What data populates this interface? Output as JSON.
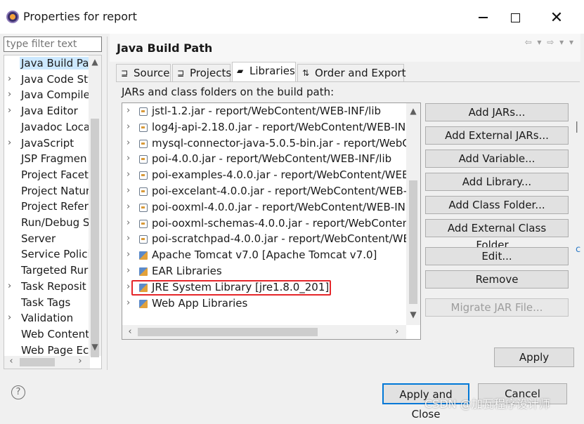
{
  "window": {
    "title": "Properties for report",
    "controls": [
      "minimize",
      "maximize",
      "close"
    ]
  },
  "filter": {
    "placeholder": "type filter text"
  },
  "nav_tree": {
    "items": [
      {
        "label": "Java Build Pa",
        "arrow": "",
        "selected": true
      },
      {
        "label": "Java Code Sty",
        "arrow": "›"
      },
      {
        "label": "Java Compile",
        "arrow": "›"
      },
      {
        "label": "Java Editor",
        "arrow": "›"
      },
      {
        "label": "Javadoc Loca",
        "arrow": ""
      },
      {
        "label": "JavaScript",
        "arrow": "›"
      },
      {
        "label": "JSP Fragmen",
        "arrow": ""
      },
      {
        "label": "Project Facet",
        "arrow": ""
      },
      {
        "label": "Project Natur",
        "arrow": ""
      },
      {
        "label": "Project Refer",
        "arrow": ""
      },
      {
        "label": "Run/Debug S",
        "arrow": ""
      },
      {
        "label": "Server",
        "arrow": ""
      },
      {
        "label": "Service Polici",
        "arrow": ""
      },
      {
        "label": "Targeted Rur",
        "arrow": ""
      },
      {
        "label": "Task Reposit",
        "arrow": "›"
      },
      {
        "label": "Task Tags",
        "arrow": ""
      },
      {
        "label": "Validation",
        "arrow": "›"
      },
      {
        "label": "Web Content",
        "arrow": ""
      },
      {
        "label": "Web Page Ec",
        "arrow": ""
      }
    ]
  },
  "panel": {
    "title": "Java Build Path",
    "tabs": [
      {
        "label": "Source",
        "icon": "source-folder-icon"
      },
      {
        "label": "Projects",
        "icon": "projects-icon"
      },
      {
        "label": "Libraries",
        "icon": "libraries-icon",
        "active": true
      },
      {
        "label": "Order and Export",
        "icon": "order-export-icon"
      }
    ],
    "list_caption": "JARs and class folders on the build path:"
  },
  "libraries": [
    {
      "label": "jstl-1.2.jar - report/WebContent/WEB-INF/lib",
      "kind": "jar"
    },
    {
      "label": "log4j-api-2.18.0.jar - report/WebContent/WEB-IN",
      "kind": "jar"
    },
    {
      "label": "mysql-connector-java-5.0.5-bin.jar - report/WebC",
      "kind": "jar"
    },
    {
      "label": "poi-4.0.0.jar - report/WebContent/WEB-INF/lib",
      "kind": "jar"
    },
    {
      "label": "poi-examples-4.0.0.jar - report/WebContent/WEB",
      "kind": "jar"
    },
    {
      "label": "poi-excelant-4.0.0.jar - report/WebContent/WEB-",
      "kind": "jar"
    },
    {
      "label": "poi-ooxml-4.0.0.jar - report/WebContent/WEB-IN",
      "kind": "jar"
    },
    {
      "label": "poi-ooxml-schemas-4.0.0.jar - report/WebConten",
      "kind": "jar"
    },
    {
      "label": "poi-scratchpad-4.0.0.jar - report/WebContent/WE",
      "kind": "jar"
    },
    {
      "label": "Apache Tomcat v7.0 [Apache Tomcat v7.0]",
      "kind": "lib"
    },
    {
      "label": "EAR Libraries",
      "kind": "lib"
    },
    {
      "label": "JRE System Library [jre1.8.0_201]",
      "kind": "lib",
      "highlighted": true
    },
    {
      "label": "Web App Libraries",
      "kind": "lib"
    }
  ],
  "side_buttons": [
    {
      "label": "Add JARs...",
      "enabled": true
    },
    {
      "label": "Add External JARs...",
      "enabled": true
    },
    {
      "label": "Add Variable...",
      "enabled": true
    },
    {
      "label": "Add Library...",
      "enabled": true
    },
    {
      "label": "Add Class Folder...",
      "enabled": true
    },
    {
      "label": "Add External Class Folder...",
      "enabled": true
    },
    {
      "label": "Edit...",
      "enabled": true
    },
    {
      "label": "Remove",
      "enabled": true
    },
    {
      "label": "Migrate JAR File...",
      "enabled": false
    }
  ],
  "footer": {
    "apply": "Apply",
    "apply_and_close": "Apply and Close",
    "cancel": "Cancel",
    "help": "?"
  },
  "watermark": "CSDN @加瓦程序设计师",
  "colors": {
    "highlight_border": "#e5262a",
    "selection": "#cce8ff",
    "default_button_border": "#0078d7"
  }
}
